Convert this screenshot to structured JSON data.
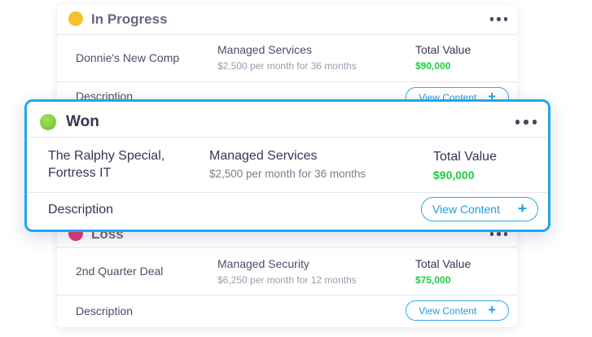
{
  "cards": {
    "in_progress": {
      "status": "In Progress",
      "status_color": "#f6c12a",
      "client": "Donnie's New Comp",
      "service": "Managed Services",
      "service_detail": "$2,500 per month for 36 months",
      "total_label": "Total Value",
      "total_value": "$90,000",
      "description_label": "Description",
      "view_button": "View Content",
      "view_icon": "plus-icon"
    },
    "won": {
      "status": "Won",
      "status_color": "#7ccd3a",
      "client_line1": "The Ralphy Special,",
      "client_line2": "Fortress IT",
      "service": "Managed Services",
      "service_detail": "$2,500 per month for 36 months",
      "total_label": "Total Value",
      "total_value": "$90,000",
      "description_label": "Description",
      "view_button": "View Content",
      "view_icon": "plus-icon"
    },
    "loss": {
      "status": "Loss",
      "status_color": "#e8337a",
      "client": "2nd Quarter Deal",
      "service": "Managed Security",
      "service_detail": "$6,250 per month for 12 months",
      "total_label": "Total Value",
      "total_value": "$75,000",
      "description_label": "Description",
      "view_button": "View Content",
      "view_icon": "plus-icon"
    }
  },
  "colors": {
    "accent": "#21a6ec",
    "value_green": "#22cc44"
  }
}
